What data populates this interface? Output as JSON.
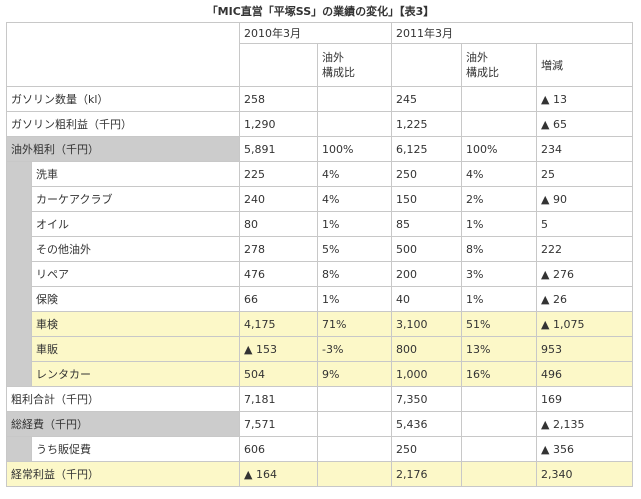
{
  "title": "「MIC直営「平塚SS」の業績の変化」【表3】",
  "header": {
    "year1": "2010年3月",
    "year2": "2011年3月",
    "ratio_line1": "油外",
    "ratio_line2": "構成比",
    "diff": "増減"
  },
  "rows": [
    {
      "label": "ガソリン数量（kl）",
      "v1": "258",
      "r1": "",
      "v2": "245",
      "r2": "",
      "d": "▲ 13"
    },
    {
      "label": "ガソリン粗利益（千円）",
      "v1": "1,290",
      "r1": "",
      "v2": "1,225",
      "r2": "",
      "d": "▲ 65"
    },
    {
      "label": "油外粗利（千円）",
      "v1": "5,891",
      "r1": "100%",
      "v2": "6,125",
      "r2": "100%",
      "d": "234"
    },
    {
      "label": "洗車",
      "v1": "225",
      "r1": "4%",
      "v2": "250",
      "r2": "4%",
      "d": "25"
    },
    {
      "label": "カーケアクラブ",
      "v1": "240",
      "r1": "4%",
      "v2": "150",
      "r2": "2%",
      "d": "▲ 90"
    },
    {
      "label": "オイル",
      "v1": "80",
      "r1": "1%",
      "v2": "85",
      "r2": "1%",
      "d": "5"
    },
    {
      "label": "その他油外",
      "v1": "278",
      "r1": "5%",
      "v2": "500",
      "r2": "8%",
      "d": "222"
    },
    {
      "label": "リペア",
      "v1": "476",
      "r1": "8%",
      "v2": "200",
      "r2": "3%",
      "d": "▲ 276"
    },
    {
      "label": "保険",
      "v1": "66",
      "r1": "1%",
      "v2": "40",
      "r2": "1%",
      "d": "▲ 26"
    },
    {
      "label": "車検",
      "v1": "4,175",
      "r1": "71%",
      "v2": "3,100",
      "r2": "51%",
      "d": "▲ 1,075"
    },
    {
      "label": "車販",
      "v1": "▲ 153",
      "r1": "-3%",
      "v2": "800",
      "r2": "13%",
      "d": "953"
    },
    {
      "label": "レンタカー",
      "v1": "504",
      "r1": "9%",
      "v2": "1,000",
      "r2": "16%",
      "d": "496"
    },
    {
      "label": "粗利合計（千円）",
      "v1": "7,181",
      "r1": "",
      "v2": "7,350",
      "r2": "",
      "d": "169"
    },
    {
      "label": "総経費（千円）",
      "v1": "7,571",
      "r1": "",
      "v2": "5,436",
      "r2": "",
      "d": "▲ 2,135"
    },
    {
      "label": "うち販促費",
      "v1": "606",
      "r1": "",
      "v2": "250",
      "r2": "",
      "d": "▲ 356"
    },
    {
      "label": "経常利益（千円）",
      "v1": "▲ 164",
      "r1": "",
      "v2": "2,176",
      "r2": "",
      "d": "2,340"
    }
  ]
}
